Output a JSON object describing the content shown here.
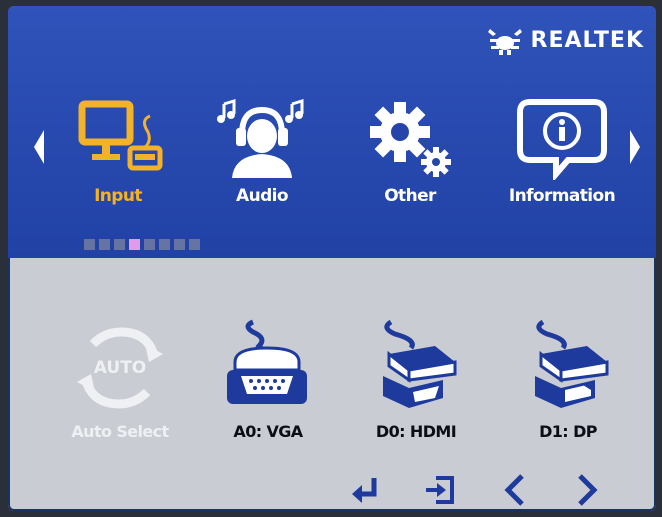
{
  "brand": {
    "name": "REALTEK",
    "icon": "realtek-crab-logo"
  },
  "menu": {
    "items": [
      {
        "label": "Input",
        "icon": "monitor-keyboard-icon",
        "selected": true
      },
      {
        "label": "Audio",
        "icon": "headset-person-icon",
        "selected": false
      },
      {
        "label": "Other",
        "icon": "gears-icon",
        "selected": false
      },
      {
        "label": "Information",
        "icon": "info-bubble-icon",
        "selected": false
      }
    ],
    "page_indicator": {
      "count": 8,
      "active_index": 3
    }
  },
  "sources": [
    {
      "label": "Auto Select",
      "icon": "auto-cycle-icon",
      "enabled": false,
      "icon_text": "AUTO"
    },
    {
      "label": "A0: VGA",
      "icon": "vga-connector-icon",
      "enabled": true
    },
    {
      "label": "D0: HDMI",
      "icon": "hdmi-connector-icon",
      "enabled": true
    },
    {
      "label": "D1: DP",
      "icon": "displayport-connector-icon",
      "enabled": true
    }
  ],
  "controls": [
    {
      "icon": "enter-icon"
    },
    {
      "icon": "exit-icon"
    },
    {
      "icon": "left-icon"
    },
    {
      "icon": "right-icon"
    }
  ],
  "colors": {
    "header_blue": "#2a4ab0",
    "panel_gray": "#c9ccd2",
    "selected_label": "#f7b221",
    "icon_gold": "#f2b22a",
    "control_blue": "#1e3a9c",
    "indicator_active": "#e09ce8"
  }
}
